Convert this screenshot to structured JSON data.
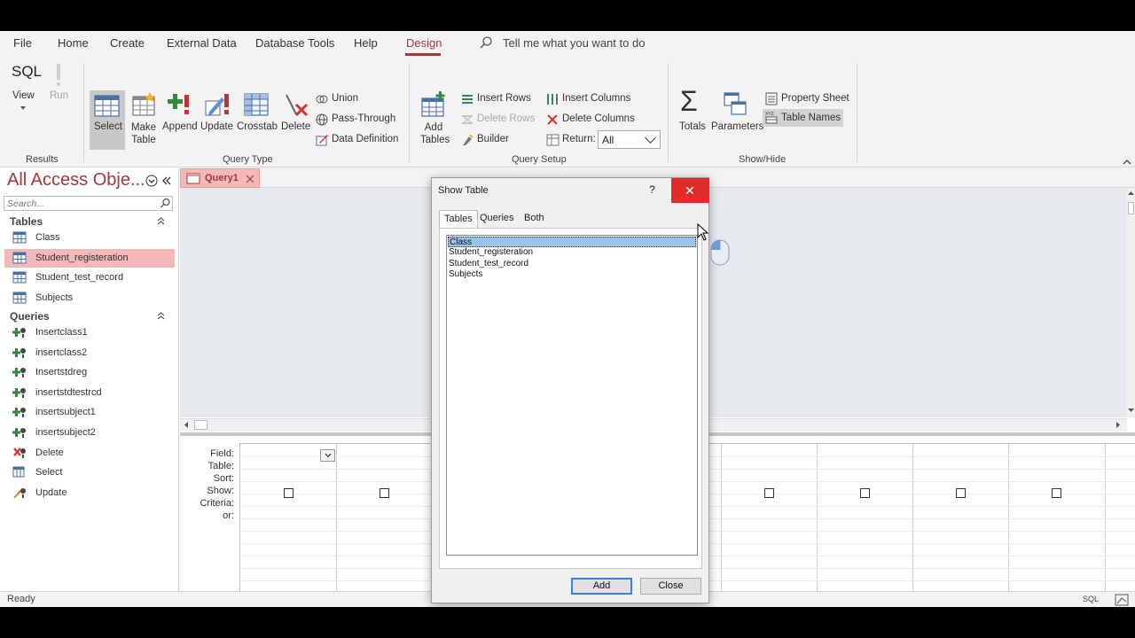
{
  "menu": {
    "items": [
      "File",
      "Home",
      "Create",
      "External Data",
      "Database Tools",
      "Help",
      "Design"
    ],
    "active": "Design",
    "tell_me": "Tell me what you want to do"
  },
  "ribbon": {
    "results": {
      "group_label": "Results",
      "view_label": "View",
      "view_icon_text": "SQL",
      "run_label": "Run"
    },
    "query_type": {
      "group_label": "Query Type",
      "select_label": "Select",
      "make_table_label": "Make Table",
      "append_label": "Append",
      "update_label": "Update",
      "crosstab_label": "Crosstab",
      "delete_label": "Delete",
      "union_label": "Union",
      "pass_through_label": "Pass-Through",
      "data_definition_label": "Data Definition"
    },
    "query_setup": {
      "group_label": "Query Setup",
      "add_tables_label": "Add Tables",
      "insert_rows_label": "Insert Rows",
      "delete_rows_label": "Delete Rows",
      "builder_label": "Builder",
      "insert_columns_label": "Insert Columns",
      "delete_columns_label": "Delete Columns",
      "return_label": "Return:",
      "return_value": "All"
    },
    "show_hide": {
      "group_label": "Show/Hide",
      "totals_label": "Totals",
      "parameters_label": "Parameters",
      "property_sheet_label": "Property Sheet",
      "table_names_label": "Table Names"
    }
  },
  "nav": {
    "title": "All Access Obje...",
    "search_placeholder": "Search...",
    "tables_header": "Tables",
    "tables": [
      "Class",
      "Student_registeration",
      "Student_test_record",
      "Subjects"
    ],
    "selected_table": "Student_registeration",
    "queries_header": "Queries",
    "queries": [
      {
        "name": "Insertclass1",
        "kind": "append"
      },
      {
        "name": "insertclass2",
        "kind": "append"
      },
      {
        "name": "Insertstdreg",
        "kind": "append"
      },
      {
        "name": "insertstdtestrcd",
        "kind": "append"
      },
      {
        "name": "insertsubject1",
        "kind": "append"
      },
      {
        "name": "insertsubject2",
        "kind": "append"
      },
      {
        "name": "Delete",
        "kind": "delete"
      },
      {
        "name": "Select",
        "kind": "select"
      },
      {
        "name": "Update",
        "kind": "update"
      }
    ]
  },
  "document": {
    "tab_label": "Query1",
    "grid_row_labels": [
      "Field:",
      "Table:",
      "Sort:",
      "Show:",
      "Criteria:",
      "or:"
    ]
  },
  "dialog": {
    "title": "Show Table",
    "help": "?",
    "close_glyph": "✕",
    "tabs": [
      "Tables",
      "Queries",
      "Both"
    ],
    "active_tab": "Tables",
    "items": [
      "Class",
      "Student_registeration",
      "Student_test_record",
      "Subjects"
    ],
    "selected_item": "Class",
    "add_label": "Add",
    "close_label": "Close"
  },
  "status": {
    "text": "Ready",
    "view_label": "SQL"
  },
  "colors": {
    "accent": "#a4373a",
    "selection_pink": "#f4b8b8",
    "dialog_close_red": "#e12a2a",
    "list_selection": "#99c2ec",
    "default_button_border": "#3d7ee6"
  }
}
